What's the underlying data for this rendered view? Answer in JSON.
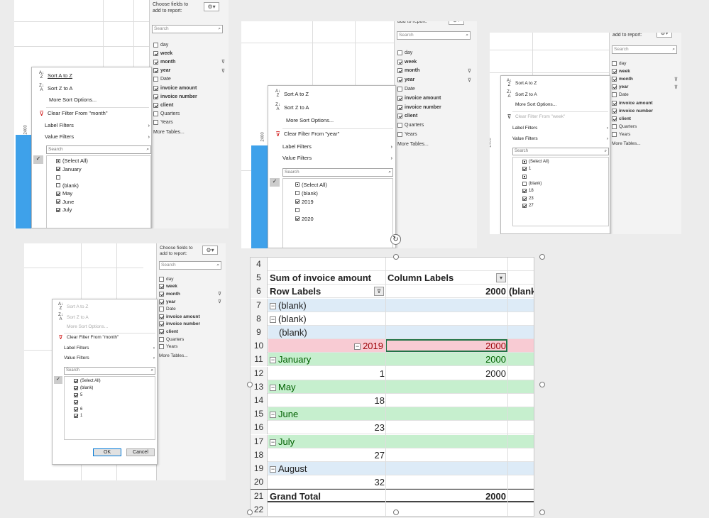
{
  "field_panel": {
    "header": "Choose fields to add to report:",
    "search_placeholder": "Search",
    "fields": [
      {
        "label": "day",
        "checked": false,
        "bold": false,
        "filtered": false
      },
      {
        "label": "week",
        "checked": true,
        "bold": true,
        "filtered": false
      },
      {
        "label": "month",
        "checked": true,
        "bold": true,
        "filtered": true
      },
      {
        "label": "year",
        "checked": true,
        "bold": true,
        "filtered": true
      },
      {
        "label": "Date",
        "checked": false,
        "bold": false,
        "filtered": false
      },
      {
        "label": "invoice amount",
        "checked": true,
        "bold": true,
        "filtered": false
      },
      {
        "label": "invoice number",
        "checked": true,
        "bold": true,
        "filtered": false
      },
      {
        "label": "client",
        "checked": true,
        "bold": true,
        "filtered": false
      },
      {
        "label": "Quarters",
        "checked": false,
        "bold": false,
        "filtered": false
      },
      {
        "label": "Years",
        "checked": false,
        "bold": false,
        "filtered": false
      }
    ],
    "more_tables": "More Tables..."
  },
  "menu_common": {
    "sort_az": "Sort A to Z",
    "sort_za": "Sort Z to A",
    "more_sort": "More Sort Options...",
    "label_filters": "Label Filters",
    "value_filters": "Value Filters",
    "search_placeholder": "Search",
    "ok": "OK",
    "cancel": "Cancel"
  },
  "axis_tick": "2400",
  "shot1": {
    "clear_filter": "Clear Filter From \"month\"",
    "items": [
      {
        "label": "(Select All)",
        "state": "mix"
      },
      {
        "label": "January",
        "state": "on"
      },
      {
        "label": "",
        "state": "off"
      },
      {
        "label": "(blank)",
        "state": "off"
      },
      {
        "label": "May",
        "state": "on"
      },
      {
        "label": "June",
        "state": "on"
      },
      {
        "label": "July",
        "state": "on"
      }
    ]
  },
  "shot2": {
    "header_partial": "add to report:",
    "clear_filter": "Clear Filter From \"year\"",
    "items": [
      {
        "label": "(Select All)",
        "state": "mix"
      },
      {
        "label": "(blank)",
        "state": "off"
      },
      {
        "label": "2019",
        "state": "on"
      },
      {
        "label": "",
        "state": "off"
      },
      {
        "label": "2020",
        "state": "on"
      }
    ]
  },
  "shot3": {
    "clear_filter": "Clear Filter From \"week\"",
    "items": [
      {
        "label": "(Select All)",
        "state": "mix"
      },
      {
        "label": "1",
        "state": "on"
      },
      {
        "label": "",
        "state": "mix"
      },
      {
        "label": "(blank)",
        "state": "off"
      },
      {
        "label": "18",
        "state": "on"
      },
      {
        "label": "23",
        "state": "on"
      },
      {
        "label": "27",
        "state": "on"
      }
    ]
  },
  "shot4": {
    "clear_filter": "Clear Filter From \"month\"",
    "items": [
      {
        "label": "(Select All)",
        "state": "on"
      },
      {
        "label": "(blank)",
        "state": "on"
      },
      {
        "label": "5",
        "state": "on"
      },
      {
        "label": "",
        "state": "on"
      },
      {
        "label": "6",
        "state": "on"
      },
      {
        "label": "1",
        "state": "on"
      }
    ]
  },
  "pivot": {
    "colors": {
      "blue": "#ddebf7",
      "green": "#c6efce",
      "red": "#f8cbd3",
      "red_text": "#9c0006",
      "green_text": "#006100"
    },
    "rows": [
      {
        "n": "4",
        "a": "",
        "b": "",
        "c": "",
        "style": "none"
      },
      {
        "n": "5",
        "a": "Sum of invoice amount",
        "b": "Column Labels",
        "c": "",
        "style": "hdr"
      },
      {
        "n": "6",
        "a": "Row Labels",
        "b": "2000",
        "c": "(blank",
        "style": "hdr2"
      },
      {
        "n": "7",
        "a": "(blank)",
        "b": "",
        "c": "",
        "style": "blue",
        "exp": true
      },
      {
        "n": "8",
        "a": "(blank)",
        "b": "",
        "c": "",
        "style": "none",
        "exp": true
      },
      {
        "n": "9",
        "a": "(blank)",
        "b": "",
        "c": "",
        "style": "blue",
        "indent": true
      },
      {
        "n": "10",
        "a": "2019",
        "b": "2000",
        "c": "",
        "style": "red",
        "exp": true
      },
      {
        "n": "11",
        "a": "January",
        "b": "2000",
        "c": "",
        "style": "green",
        "exp": true
      },
      {
        "n": "12",
        "a": "1",
        "b": "2000",
        "c": "",
        "style": "num"
      },
      {
        "n": "13",
        "a": "May",
        "b": "",
        "c": "",
        "style": "green",
        "exp": true
      },
      {
        "n": "14",
        "a": "18",
        "b": "",
        "c": "",
        "style": "num"
      },
      {
        "n": "15",
        "a": "June",
        "b": "",
        "c": "",
        "style": "green",
        "exp": true
      },
      {
        "n": "16",
        "a": "23",
        "b": "",
        "c": "",
        "style": "num"
      },
      {
        "n": "17",
        "a": "July",
        "b": "",
        "c": "",
        "style": "green",
        "exp": true
      },
      {
        "n": "18",
        "a": "27",
        "b": "",
        "c": "",
        "style": "num"
      },
      {
        "n": "19",
        "a": "August",
        "b": "",
        "c": "",
        "style": "blue",
        "exp": true
      },
      {
        "n": "20",
        "a": "32",
        "b": "",
        "c": "",
        "style": "num"
      },
      {
        "n": "21",
        "a": "Grand Total",
        "b": "2000",
        "c": "",
        "style": "total"
      },
      {
        "n": "22",
        "a": "",
        "b": "",
        "c": "",
        "style": "none"
      }
    ]
  }
}
